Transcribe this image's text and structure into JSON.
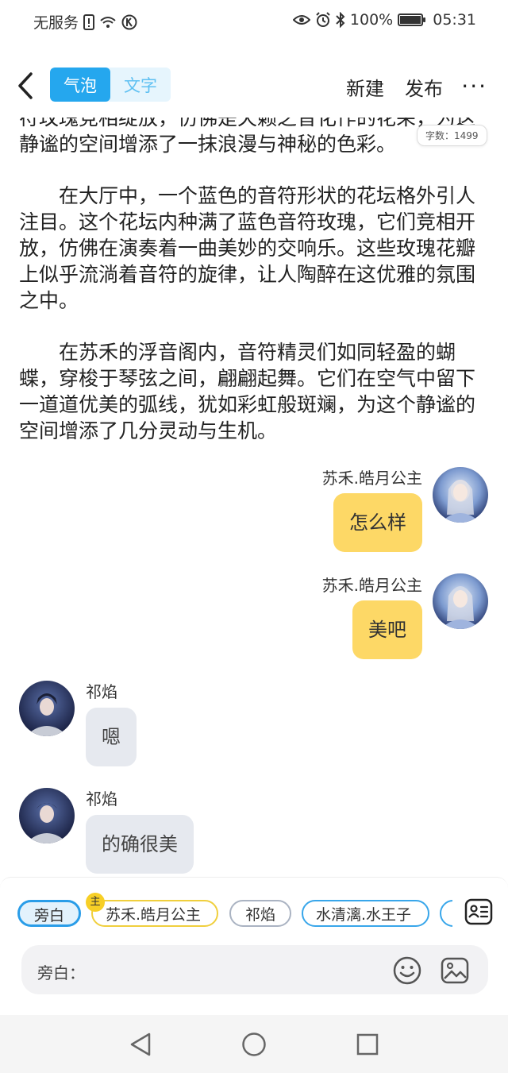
{
  "status_bar": {
    "carrier": "无服务",
    "battery": "100%",
    "time": "05:31"
  },
  "header": {
    "tabs": [
      {
        "label": "气泡",
        "active": true
      },
      {
        "label": "文字",
        "active": false
      }
    ],
    "new_label": "新建",
    "publish_label": "发布",
    "more_label": "···"
  },
  "word_count": "字数：1499",
  "story": [
    "符玫瑰竞相绽放，仿佛是天籁之音化作的花朵，为这静谧的空间增添了一抹浪漫与神秘的色彩。",
    "在大厅中，一个蓝色的音符形状的花坛格外引人注目。这个花坛内种满了蓝色音符玫瑰，它们竞相开放，仿佛在演奏着一曲美妙的交响乐。这些玫瑰花瓣上似乎流淌着音符的旋律，让人陶醉在这优雅的氛围之中。",
    "在苏禾的浮音阁内，音符精灵们如同轻盈的蝴蝶，穿梭于琴弦之间，翩翩起舞。它们在空气中留下一道道优美的弧线，犹如彩虹般斑斓，为这个静谧的空间增添了几分灵动与生机。"
  ],
  "messages": [
    {
      "sender": "苏禾.皓月公主",
      "text": "怎么样",
      "side": "right"
    },
    {
      "sender": "苏禾.皓月公主",
      "text": "美吧",
      "side": "right"
    },
    {
      "sender": "祁焰",
      "text": "嗯",
      "side": "left"
    },
    {
      "sender": "祁焰",
      "text": "的确很美",
      "side": "left"
    }
  ],
  "roles": [
    {
      "label": "旁白",
      "selected": true
    },
    {
      "label": "苏禾.皓月公主",
      "badge": "主"
    },
    {
      "label": "祁焰"
    },
    {
      "label": "水清漓.水王子"
    }
  ],
  "input": {
    "label": "旁白："
  },
  "colors": {
    "accent": "#25a7ee",
    "bubble_right": "#fdd866",
    "bubble_left": "#e6e9ef"
  }
}
